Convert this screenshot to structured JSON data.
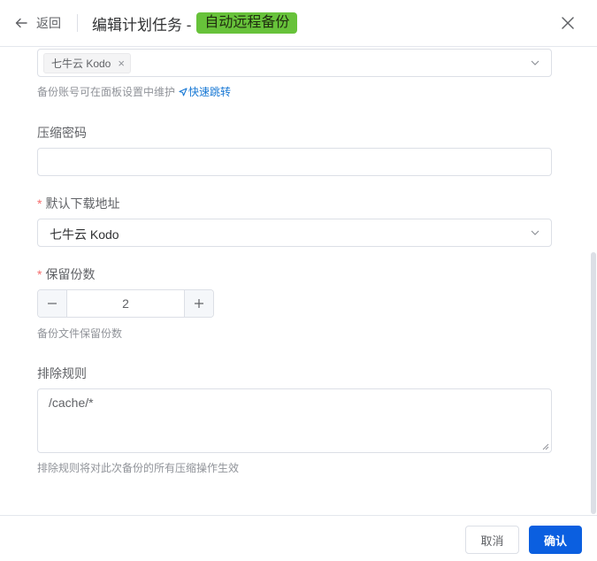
{
  "header": {
    "back_label": "返回",
    "title": "编辑计划任务 -",
    "badge": "自动远程备份"
  },
  "form": {
    "backup_account": {
      "tag": "七牛云 Kodo",
      "hint": "备份账号可在面板设置中维护",
      "link": "快速跳转"
    },
    "compress_password": {
      "label": "压缩密码",
      "value": ""
    },
    "default_download": {
      "label": "默认下载地址",
      "value": "七牛云 Kodo",
      "required": "*"
    },
    "retain_count": {
      "label": "保留份数",
      "value": "2",
      "required": "*",
      "hint": "备份文件保留份数"
    },
    "exclude_rules": {
      "label": "排除规则",
      "value": "/cache/*",
      "hint": "排除规则将对此次备份的所有压缩操作生效"
    }
  },
  "footer": {
    "cancel_label": "取消",
    "confirm_label": "确认"
  },
  "colors": {
    "primary": "#0b5fe0",
    "badge_bg": "#67c23a",
    "required": "#f56c6c",
    "link": "#1677d4"
  }
}
